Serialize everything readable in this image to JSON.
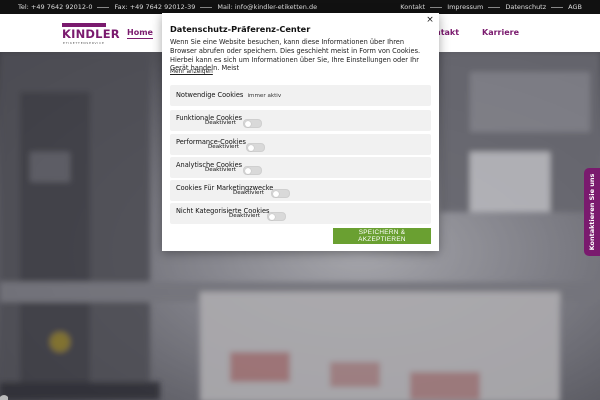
{
  "topbar": {
    "tel": "Tel: +49 7642 92012-0",
    "fax": "Fax: +49 7642 92012-39",
    "mail": "Mail: info@kindler-etiketten.de",
    "links": [
      "Kontakt",
      "Impressum",
      "Datenschutz",
      "AGB"
    ]
  },
  "header": {
    "logo_text": "KINDLER",
    "logo_sub": "ETIKETTENSERVICE",
    "nav": {
      "home": "Home",
      "kontakt": "ntakt",
      "karriere": "Karriere"
    }
  },
  "modal": {
    "title": "Datenschutz-Präferenz-Center",
    "close": "×",
    "description": "Wenn Sie eine Website besuchen, kann diese Informationen über Ihren Browser abrufen oder speichern. Dies geschieht meist in Form von Cookies. Hierbei kann es sich um Informationen über Sie, Ihre Einstellungen oder Ihr Gerät handeln. Meist",
    "more_link": "Mehr anzeigen",
    "preferences": [
      {
        "label": "Notwendige Cookies",
        "status": "immer aktiv"
      },
      {
        "label": "Funktionale Cookies",
        "status": "Deaktiviert"
      },
      {
        "label": "Performance-Cookies",
        "status": "Deaktiviert"
      },
      {
        "label": "Analytische Cookies",
        "status": "Deaktiviert"
      },
      {
        "label": "Cookies Für Marketingzwecke",
        "status": "Deaktiviert"
      },
      {
        "label": "Nicht Kategorisierte Cookies",
        "status": "Deaktiviert"
      }
    ],
    "save_button": "SPEICHERN & AKZEPTIEREN"
  },
  "side_tab": {
    "label": "Kontaktieren Sie uns"
  },
  "colors": {
    "brand": "#7a1a6e",
    "accept": "#6aa031",
    "topbar": "#111111"
  }
}
